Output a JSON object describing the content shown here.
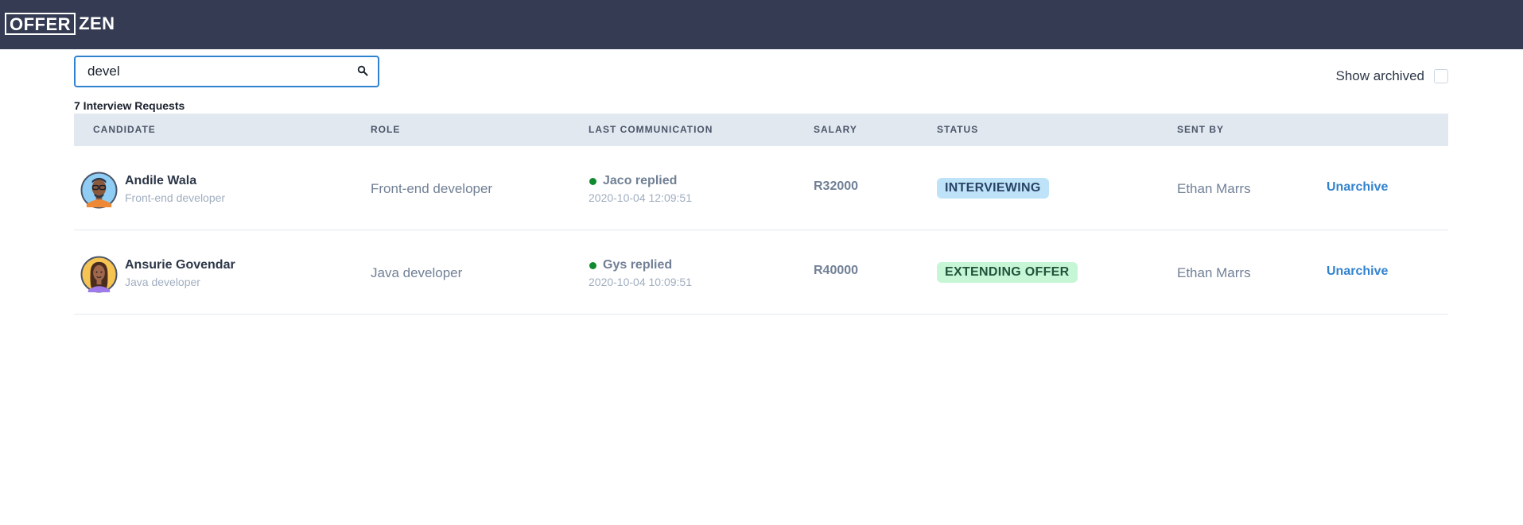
{
  "brand": {
    "logo_boxed": "OFFER",
    "logo_plain": "ZEN"
  },
  "search": {
    "value": "devel",
    "placeholder": ""
  },
  "filters": {
    "show_archived_label": "Show archived",
    "show_archived_checked": false
  },
  "summary": {
    "count_label": "7 Interview Requests"
  },
  "table": {
    "headers": {
      "candidate": "CANDIDATE",
      "role": "ROLE",
      "last_communication": "LAST COMMUNICATION",
      "salary": "SALARY",
      "status": "STATUS",
      "sent_by": "SENT BY"
    },
    "rows": [
      {
        "name": "Andile Wala",
        "subtitle": "Front-end developer",
        "role": "Front-end developer",
        "comm_text": "Jaco replied",
        "comm_time": "2020-10-04 12:09:51",
        "salary": "R32000",
        "status": "INTERVIEWING",
        "sent_by": "Ethan Marrs",
        "action": "Unarchive"
      },
      {
        "name": "Ansurie Govendar",
        "subtitle": "Java developer",
        "role": "Java developer",
        "comm_text": "Gys replied",
        "comm_time": "2020-10-04 10:09:51",
        "salary": "R40000",
        "status": "EXTENDING OFFER",
        "sent_by": "Ethan Marrs",
        "action": "Unarchive"
      }
    ]
  },
  "colors": {
    "topbar": "#343b52",
    "accent": "#3182ce",
    "status_interviewing_bg": "#bee3f8",
    "status_offer_bg": "#c6f6d5",
    "online_dot": "#0f8a2f"
  }
}
